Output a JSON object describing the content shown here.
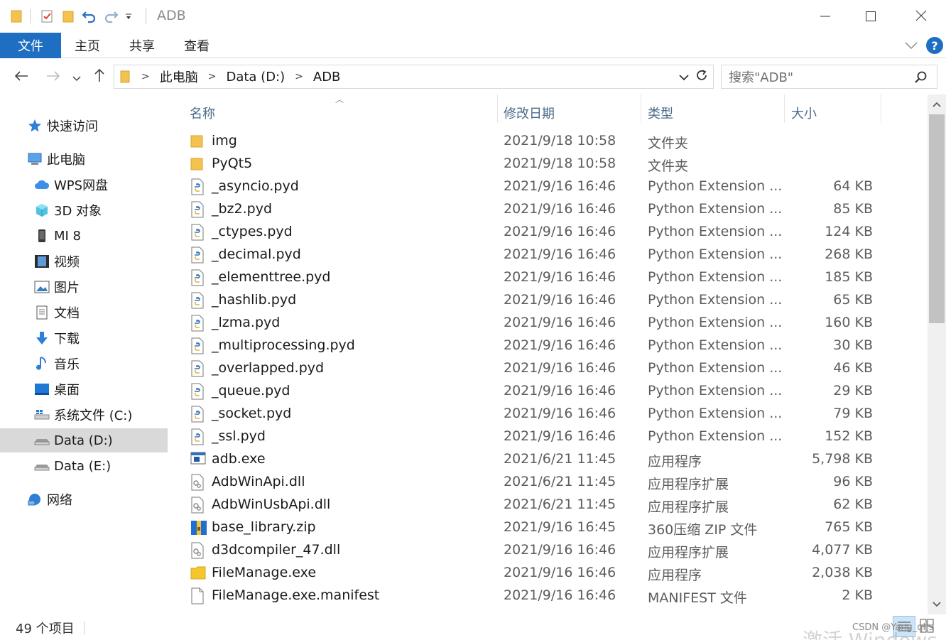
{
  "window": {
    "title": "ADB",
    "minimize_icon": "minimize-icon",
    "maximize_icon": "maximize-icon",
    "close_icon": "close-icon"
  },
  "ribbon": {
    "tabs": [
      "文件",
      "主页",
      "共享",
      "查看"
    ],
    "accent": "#1e6fc2",
    "help_label": "?"
  },
  "address": {
    "crumbs": [
      "此电脑",
      "Data (D:)",
      "ADB"
    ]
  },
  "search": {
    "placeholder": "搜索\"ADB\""
  },
  "nav": {
    "items": [
      {
        "label": "快速访问",
        "icon": "star-icon"
      },
      {
        "label": "此电脑",
        "icon": "computer-icon"
      },
      {
        "label": "WPS网盘",
        "icon": "cloud-icon"
      },
      {
        "label": "3D 对象",
        "icon": "cube-icon"
      },
      {
        "label": "MI 8",
        "icon": "phone-icon"
      },
      {
        "label": "视频",
        "icon": "film-icon"
      },
      {
        "label": "图片",
        "icon": "picture-icon"
      },
      {
        "label": "文档",
        "icon": "document-icon"
      },
      {
        "label": "下载",
        "icon": "download-icon"
      },
      {
        "label": "音乐",
        "icon": "music-icon"
      },
      {
        "label": "桌面",
        "icon": "desktop-icon"
      },
      {
        "label": "系统文件 (C:)",
        "icon": "drive-icon"
      },
      {
        "label": "Data (D:)",
        "icon": "drive-icon"
      },
      {
        "label": "Data (E:)",
        "icon": "drive-icon"
      },
      {
        "label": "网络",
        "icon": "network-icon"
      }
    ],
    "selected": "Data (D:)"
  },
  "columns": {
    "name": "名称",
    "date": "修改日期",
    "type": "类型",
    "size": "大小"
  },
  "files": [
    {
      "name": "img",
      "date": "2021/9/18 10:58",
      "type": "文件夹",
      "size": "",
      "icon": "folder-icon"
    },
    {
      "name": "PyQt5",
      "date": "2021/9/18 10:58",
      "type": "文件夹",
      "size": "",
      "icon": "folder-icon"
    },
    {
      "name": "_asyncio.pyd",
      "date": "2021/9/16 16:46",
      "type": "Python Extension ...",
      "size": "64 KB",
      "icon": "python-file-icon"
    },
    {
      "name": "_bz2.pyd",
      "date": "2021/9/16 16:46",
      "type": "Python Extension ...",
      "size": "85 KB",
      "icon": "python-file-icon"
    },
    {
      "name": "_ctypes.pyd",
      "date": "2021/9/16 16:46",
      "type": "Python Extension ...",
      "size": "124 KB",
      "icon": "python-file-icon"
    },
    {
      "name": "_decimal.pyd",
      "date": "2021/9/16 16:46",
      "type": "Python Extension ...",
      "size": "268 KB",
      "icon": "python-file-icon"
    },
    {
      "name": "_elementtree.pyd",
      "date": "2021/9/16 16:46",
      "type": "Python Extension ...",
      "size": "185 KB",
      "icon": "python-file-icon"
    },
    {
      "name": "_hashlib.pyd",
      "date": "2021/9/16 16:46",
      "type": "Python Extension ...",
      "size": "65 KB",
      "icon": "python-file-icon"
    },
    {
      "name": "_lzma.pyd",
      "date": "2021/9/16 16:46",
      "type": "Python Extension ...",
      "size": "160 KB",
      "icon": "python-file-icon"
    },
    {
      "name": "_multiprocessing.pyd",
      "date": "2021/9/16 16:46",
      "type": "Python Extension ...",
      "size": "30 KB",
      "icon": "python-file-icon"
    },
    {
      "name": "_overlapped.pyd",
      "date": "2021/9/16 16:46",
      "type": "Python Extension ...",
      "size": "46 KB",
      "icon": "python-file-icon"
    },
    {
      "name": "_queue.pyd",
      "date": "2021/9/16 16:46",
      "type": "Python Extension ...",
      "size": "29 KB",
      "icon": "python-file-icon"
    },
    {
      "name": "_socket.pyd",
      "date": "2021/9/16 16:46",
      "type": "Python Extension ...",
      "size": "79 KB",
      "icon": "python-file-icon"
    },
    {
      "name": "_ssl.pyd",
      "date": "2021/9/16 16:46",
      "type": "Python Extension ...",
      "size": "152 KB",
      "icon": "python-file-icon"
    },
    {
      "name": "adb.exe",
      "date": "2021/6/21 11:45",
      "type": "应用程序",
      "size": "5,798 KB",
      "icon": "exe-icon"
    },
    {
      "name": "AdbWinApi.dll",
      "date": "2021/6/21 11:45",
      "type": "应用程序扩展",
      "size": "96 KB",
      "icon": "dll-icon"
    },
    {
      "name": "AdbWinUsbApi.dll",
      "date": "2021/6/21 11:45",
      "type": "应用程序扩展",
      "size": "62 KB",
      "icon": "dll-icon"
    },
    {
      "name": "base_library.zip",
      "date": "2021/9/16 16:45",
      "type": "360压缩 ZIP 文件",
      "size": "765 KB",
      "icon": "zip-icon"
    },
    {
      "name": "d3dcompiler_47.dll",
      "date": "2021/9/16 16:46",
      "type": "应用程序扩展",
      "size": "4,077 KB",
      "icon": "dll-icon"
    },
    {
      "name": "FileManage.exe",
      "date": "2021/9/16 16:46",
      "type": "应用程序",
      "size": "2,038 KB",
      "icon": "app-folder-icon"
    },
    {
      "name": "FileManage.exe.manifest",
      "date": "2021/9/16 16:46",
      "type": "MANIFEST 文件",
      "size": "2 KB",
      "icon": "blank-file-icon"
    }
  ],
  "status": {
    "count": "49 个项目"
  },
  "overlay": {
    "watermark": "激活 Windows",
    "csdn": "CSDN @Yang_qhs"
  }
}
